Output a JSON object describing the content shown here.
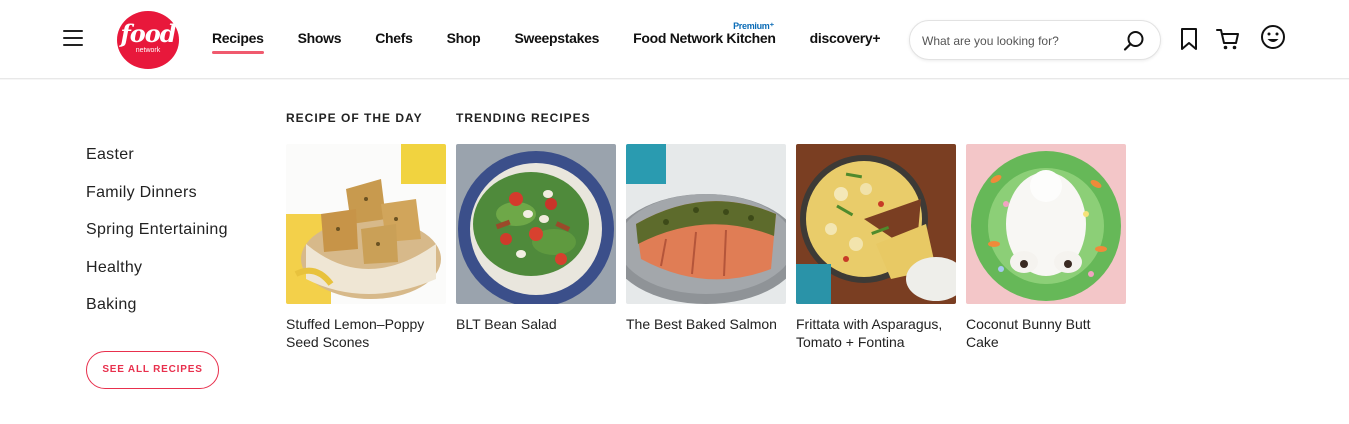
{
  "header": {
    "logo_text": "food",
    "logo_sub": "network",
    "nav": [
      {
        "label": "Recipes",
        "active": true
      },
      {
        "label": "Shows"
      },
      {
        "label": "Chefs"
      },
      {
        "label": "Shop"
      },
      {
        "label": "Sweepstakes"
      },
      {
        "label": "Food Network Kitchen",
        "badge": "Premium⁺"
      },
      {
        "label": "discovery+"
      }
    ],
    "search": {
      "placeholder": "What are you looking for?"
    },
    "icons": [
      "bookmark-icon",
      "cart-icon",
      "user-smiley-icon"
    ]
  },
  "colors": {
    "brand": "#e8183b",
    "accent": "#f05a6e",
    "premium": "#0a6bb6"
  },
  "menu": {
    "categories": [
      "Easter",
      "Family Dinners",
      "Spring Entertaining",
      "Healthy",
      "Baking"
    ],
    "see_all_label": "SEE ALL RECIPES",
    "recipe_of_day_label": "RECIPE OF THE DAY",
    "trending_label": "TRENDING RECIPES",
    "recipes": [
      {
        "title": "Stuffed Lemon–Poppy Seed Scones",
        "image": "scones-photo"
      },
      {
        "title": "BLT Bean Salad",
        "image": "salad-photo"
      },
      {
        "title": "The Best Baked Salmon",
        "image": "salmon-photo"
      },
      {
        "title": "Frittata with Asparagus, Tomato + Fontina",
        "image": "frittata-photo"
      },
      {
        "title": "Coconut Bunny Butt Cake",
        "image": "bunny-cake-photo"
      }
    ]
  }
}
